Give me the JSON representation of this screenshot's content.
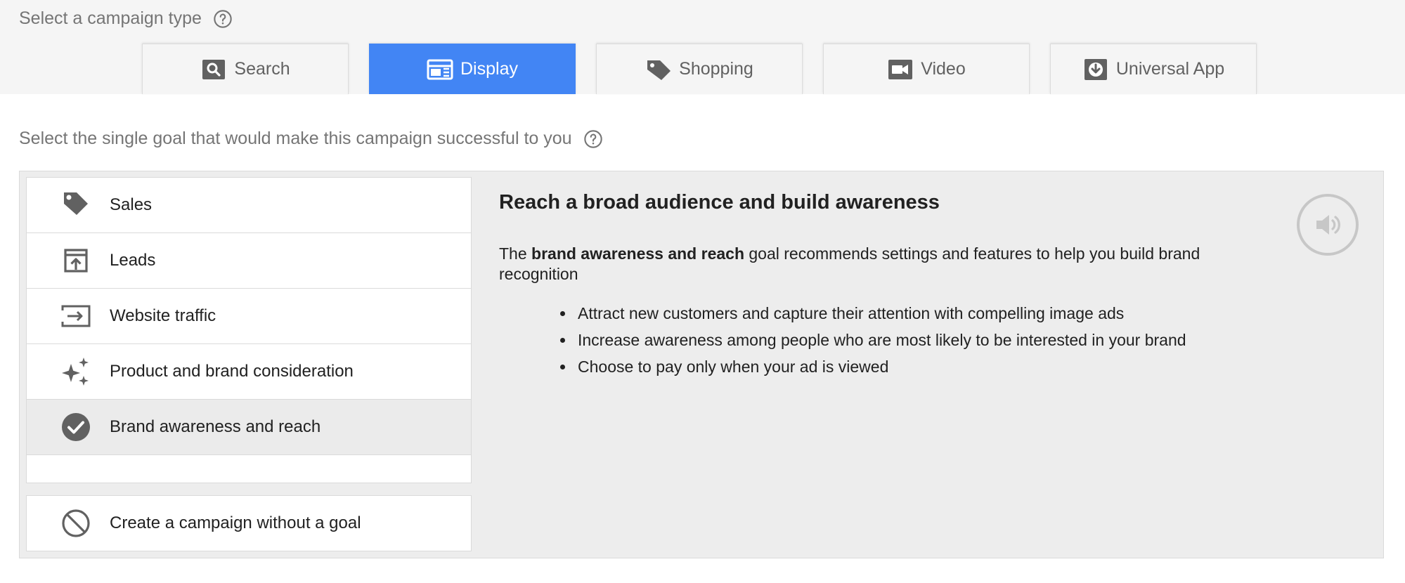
{
  "campaign_type": {
    "label": "Select a campaign type",
    "tabs": [
      {
        "label": "Search",
        "icon": "search-icon"
      },
      {
        "label": "Display",
        "icon": "display-icon"
      },
      {
        "label": "Shopping",
        "icon": "shopping-tag-icon"
      },
      {
        "label": "Video",
        "icon": "video-camera-icon"
      },
      {
        "label": "Universal App",
        "icon": "app-download-icon"
      }
    ],
    "selected": "Display",
    "active_color": "#4285f4"
  },
  "goal": {
    "label": "Select the single goal that would make this campaign successful to you",
    "items": [
      {
        "label": "Sales",
        "icon": "tag-icon"
      },
      {
        "label": "Leads",
        "icon": "upload-box-icon"
      },
      {
        "label": "Website traffic",
        "icon": "enter-arrow-icon"
      },
      {
        "label": "Product and brand consideration",
        "icon": "sparkle-icon"
      },
      {
        "label": "Brand awareness and reach",
        "icon": "check-circle-icon"
      }
    ],
    "selected": "Brand awareness and reach",
    "no_goal": {
      "label": "Create a campaign without a goal",
      "icon": "block-icon"
    }
  },
  "detail": {
    "title": "Reach a broad audience and build awareness",
    "desc_prefix": "The ",
    "desc_bold": "brand awareness and reach",
    "desc_suffix": " goal recommends settings and features to help you build brand recognition",
    "bullets": [
      "Attract new customers and capture their attention with compelling image ads",
      "Increase awareness among people who are most likely to be interested in your brand",
      "Choose to pay only when your ad is viewed"
    ],
    "audio_icon": "speaker-icon"
  }
}
